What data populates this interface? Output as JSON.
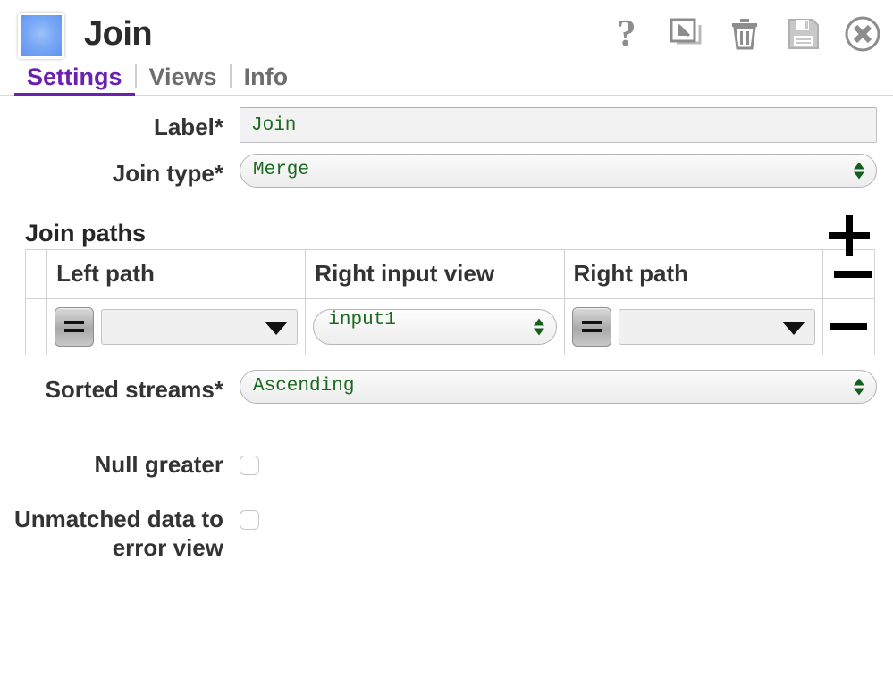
{
  "header": {
    "title": "Join",
    "icon": "node-square-icon",
    "icon_color": "#5d93f0",
    "toolbar": [
      {
        "name": "help-icon",
        "label": "?"
      },
      {
        "name": "restore-icon",
        "label": "Restore"
      },
      {
        "name": "delete-icon",
        "label": "Delete"
      },
      {
        "name": "save-icon",
        "label": "Save"
      },
      {
        "name": "close-icon",
        "label": "Close"
      }
    ]
  },
  "tabs": {
    "active": "Settings",
    "accent_color": "#6a20b0",
    "items": [
      {
        "label": "Settings"
      },
      {
        "label": "Views"
      },
      {
        "label": "Info"
      }
    ]
  },
  "fields": {
    "label": {
      "label": "Label*",
      "value": "Join",
      "placeholder": ""
    },
    "join_type": {
      "label": "Join type*",
      "value": "Merge",
      "options": [
        "Merge"
      ]
    },
    "sorted_streams": {
      "label": "Sorted streams*",
      "value": "Ascending",
      "options": [
        "Ascending"
      ]
    },
    "null_greater": {
      "label": "Null greater",
      "checked": false
    },
    "unmatched_to_error": {
      "label": "Unmatched data to error view",
      "checked": false
    }
  },
  "join_paths": {
    "title": "Join paths",
    "add_label": "+",
    "remove_label": "—",
    "columns": [
      "",
      "Left path",
      "Right input view",
      "Right path",
      ""
    ],
    "rows": [
      {
        "operator": "=",
        "left_path": "",
        "right_input_view": "input1",
        "right_operator": "=",
        "right_path": ""
      }
    ]
  }
}
